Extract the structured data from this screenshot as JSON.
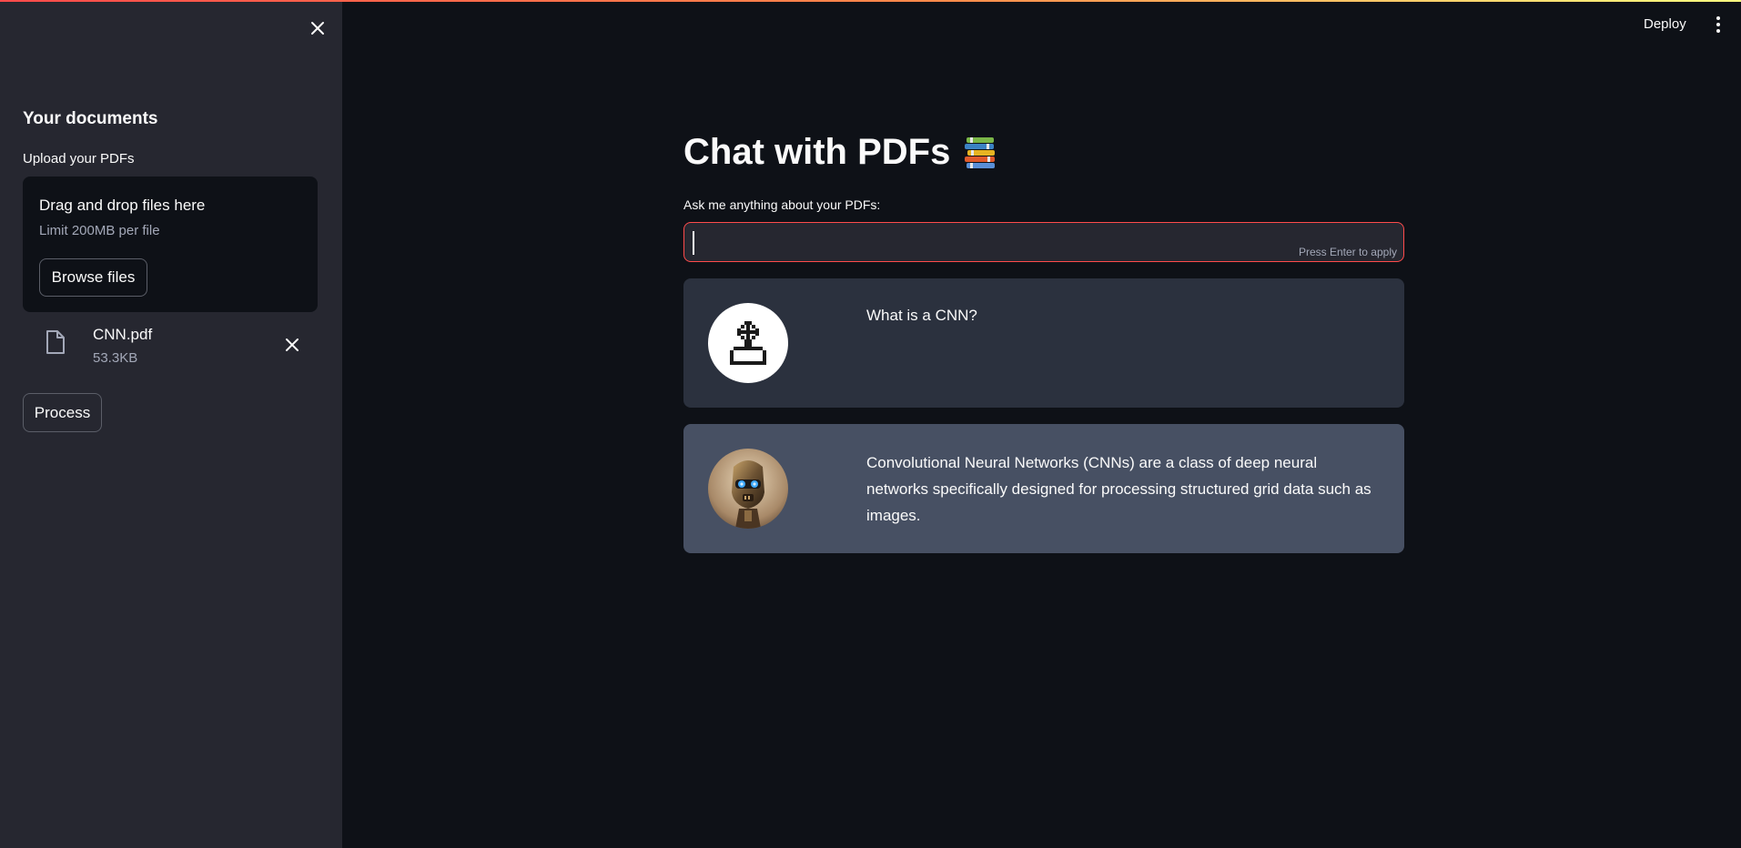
{
  "sidebar": {
    "heading": "Your documents",
    "upload_label": "Upload your PDFs",
    "dropzone": {
      "title": "Drag and drop files here",
      "limit": "Limit 200MB per file",
      "browse_label": "Browse files"
    },
    "files": [
      {
        "name": "CNN.pdf",
        "size": "53.3KB"
      }
    ],
    "process_label": "Process"
  },
  "header": {
    "deploy_label": "Deploy"
  },
  "main": {
    "title": "Chat with PDFs",
    "title_icon": "books-icon",
    "input": {
      "label": "Ask me anything about your PDFs:",
      "value": "",
      "hint": "Press Enter to apply"
    },
    "messages": [
      {
        "role": "user",
        "avatar": "user-avatar-icon",
        "text": "What is a CNN?"
      },
      {
        "role": "bot",
        "avatar": "robot-avatar",
        "text": "Convolutional Neural Networks (CNNs) are a class of deep neural networks specifically designed for processing structured grid data such as images."
      }
    ]
  },
  "colors": {
    "background": "#0e1117",
    "sidebar": "#262730",
    "accent": "#ff4b4b",
    "user_message_bg": "#2b313e",
    "bot_message_bg": "#475063"
  }
}
